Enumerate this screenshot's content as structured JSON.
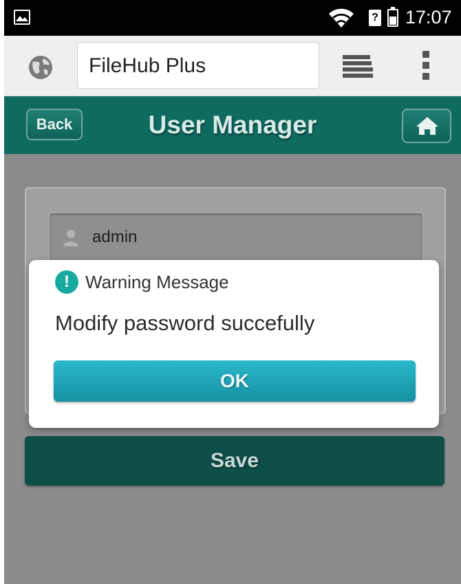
{
  "status_bar": {
    "time": "17:07",
    "icons": [
      "gallery-icon",
      "wifi-icon",
      "no-sim-icon",
      "battery-icon"
    ],
    "nosim_glyph": "?"
  },
  "browser": {
    "url_text": "FileHub Plus",
    "icons": [
      "globe-icon",
      "tabs-stack-icon",
      "overflow-menu-icon"
    ]
  },
  "header": {
    "back_label": "Back",
    "title": "User Manager",
    "home_icon": "home-icon"
  },
  "form": {
    "username_value": "admin",
    "user_icon": "user-icon",
    "save_label": "Save"
  },
  "dialog": {
    "title": "Warning Message",
    "message": "Modify password succefully",
    "ok_label": "OK",
    "icon_glyph": "!"
  },
  "colors": {
    "header_bg": "#0f6b60",
    "dialog_button": "#1fa6b8",
    "warning_icon": "#18aa9f",
    "save_button": "#0d4e47"
  }
}
